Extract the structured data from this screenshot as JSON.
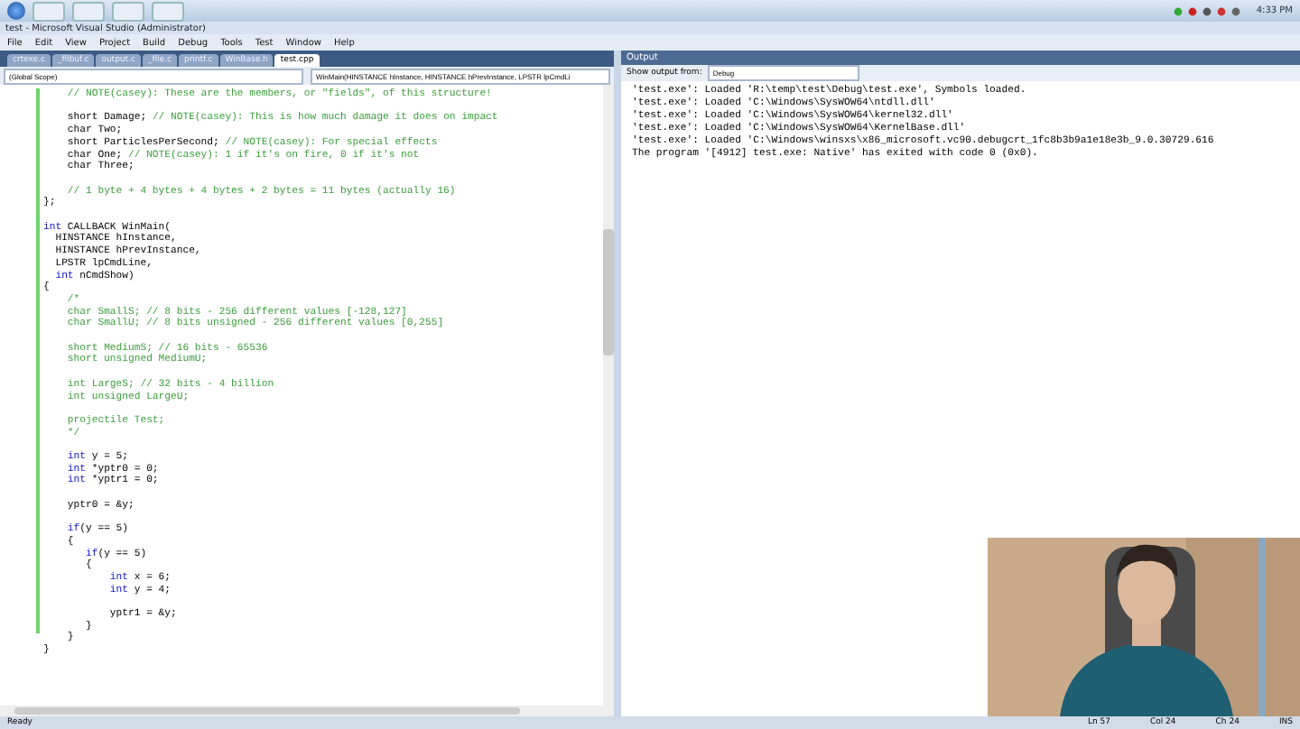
{
  "taskbar": {
    "clock": "4:33 PM"
  },
  "window": {
    "title": "test - Microsoft Visual Studio (Administrator)"
  },
  "menu": [
    "File",
    "Edit",
    "View",
    "Project",
    "Build",
    "Debug",
    "Tools",
    "Test",
    "Window",
    "Help"
  ],
  "tabs": [
    {
      "label": "crtexe.c",
      "selected": false
    },
    {
      "label": "_filbuf.c",
      "selected": false
    },
    {
      "label": "output.c",
      "selected": false
    },
    {
      "label": "_file.c",
      "selected": false
    },
    {
      "label": "printf.c",
      "selected": false
    },
    {
      "label": "WinBase.h",
      "selected": false
    },
    {
      "label": "test.cpp",
      "selected": true
    }
  ],
  "scope": {
    "left": "(Global Scope)",
    "right": "WinMain(HINSTANCE hInstance, HINSTANCE hPrevInstance, LPSTR lpCmdLi"
  },
  "code_blocks": [
    [
      [
        {
          "kind": "c",
          "text": "    // NOTE(casey): These are the members, or \"fields\", of this structure!"
        }
      ]
    ],
    [
      [
        {
          "kind": "p",
          "text": "    short Damage; "
        },
        {
          "kind": "c",
          "text": "// NOTE(casey): This is how much damage it does on impact"
        }
      ],
      [
        {
          "kind": "p",
          "text": "    char Two;"
        }
      ],
      [
        {
          "kind": "p",
          "text": "    short ParticlesPerSecond; "
        },
        {
          "kind": "c",
          "text": "// NOTE(casey): For special effects"
        }
      ],
      [
        {
          "kind": "p",
          "text": "    char One; "
        },
        {
          "kind": "c",
          "text": "// NOTE(casey): 1 if it's on fire, 0 if it's not"
        }
      ],
      [
        {
          "kind": "p",
          "text": "    char Three;"
        }
      ]
    ],
    [
      [
        {
          "kind": "c",
          "text": "    // 1 byte + 4 bytes + 4 bytes + 2 bytes = 11 bytes (actually 16)"
        }
      ],
      [
        {
          "kind": "p",
          "text": "};"
        }
      ]
    ],
    [
      [
        {
          "kind": "k",
          "text": "int"
        },
        {
          "kind": "p",
          "text": " CALLBACK WinMain("
        }
      ],
      [
        {
          "kind": "p",
          "text": "  HINSTANCE hInstance,"
        }
      ],
      [
        {
          "kind": "p",
          "text": "  HINSTANCE hPrevInstance,"
        }
      ],
      [
        {
          "kind": "p",
          "text": "  LPSTR lpCmdLine,"
        }
      ],
      [
        {
          "kind": "k",
          "text": "  int"
        },
        {
          "kind": "p",
          "text": " nCmdShow)"
        }
      ],
      [
        {
          "kind": "p",
          "text": "{"
        }
      ],
      [
        {
          "kind": "c",
          "text": "    /*"
        }
      ],
      [
        {
          "kind": "c",
          "text": "    char SmallS; // 8 bits - 256 different values [-128,127]"
        }
      ],
      [
        {
          "kind": "c",
          "text": "    char SmallU; // 8 bits unsigned - 256 different values [0,255]"
        }
      ]
    ],
    [
      [
        {
          "kind": "c",
          "text": "    short MediumS; // 16 bits - 65536"
        }
      ],
      [
        {
          "kind": "c",
          "text": "    short unsigned MediumU;"
        }
      ]
    ],
    [
      [
        {
          "kind": "c",
          "text": "    int LargeS; // 32 bits - 4 billion"
        }
      ],
      [
        {
          "kind": "c",
          "text": "    int unsigned LargeU;"
        }
      ]
    ],
    [
      [
        {
          "kind": "c",
          "text": "    projectile Test;"
        }
      ],
      [
        {
          "kind": "c",
          "text": "    */"
        }
      ]
    ],
    [
      [
        {
          "kind": "k",
          "text": "    int"
        },
        {
          "kind": "p",
          "text": " y = 5;"
        }
      ],
      [
        {
          "kind": "k",
          "text": "    int"
        },
        {
          "kind": "p",
          "text": " *yptr0 = 0;"
        }
      ],
      [
        {
          "kind": "k",
          "text": "    int"
        },
        {
          "kind": "p",
          "text": " *yptr1 = 0;"
        }
      ]
    ],
    [
      [
        {
          "kind": "p",
          "text": "    yptr0 = &y;"
        }
      ]
    ],
    [
      [
        {
          "kind": "k",
          "text": "    if"
        },
        {
          "kind": "p",
          "text": "(y == 5)"
        }
      ],
      [
        {
          "kind": "p",
          "text": "    {"
        }
      ],
      [
        {
          "kind": "k",
          "text": "       if"
        },
        {
          "kind": "p",
          "text": "(y == 5)"
        }
      ],
      [
        {
          "kind": "p",
          "text": "       {"
        }
      ],
      [
        {
          "kind": "k",
          "text": "           int"
        },
        {
          "kind": "p",
          "text": " x = 6;"
        }
      ],
      [
        {
          "kind": "k",
          "text": "           int"
        },
        {
          "kind": "p",
          "text": " y = 4;"
        }
      ]
    ],
    [
      [
        {
          "kind": "p",
          "text": "           yptr1 = &y;"
        }
      ],
      [
        {
          "kind": "p",
          "text": "       }"
        }
      ],
      [
        {
          "kind": "p",
          "text": "    }"
        }
      ],
      [
        {
          "kind": "p",
          "text": "}"
        }
      ]
    ]
  ],
  "output": {
    "title": "Output",
    "source_label": "Show output from:",
    "source": "Debug",
    "lines": [
      "'test.exe': Loaded 'R:\\temp\\test\\Debug\\test.exe', Symbols loaded.",
      "'test.exe': Loaded 'C:\\Windows\\SysWOW64\\ntdll.dll'",
      "'test.exe': Loaded 'C:\\Windows\\SysWOW64\\kernel32.dll'",
      "'test.exe': Loaded 'C:\\Windows\\SysWOW64\\KernelBase.dll'",
      "'test.exe': Loaded 'C:\\Windows\\winsxs\\x86_microsoft.vc90.debugcrt_1fc8b3b9a1e18e3b_9.0.30729.616",
      "The program '[4912] test.exe: Native' has exited with code 0 (0x0)."
    ]
  },
  "webcam": {
    "kind": "picture"
  },
  "status_bar": {
    "message": "Ready",
    "line": "Ln 57",
    "column": "Col 24",
    "char": "Ch 24",
    "mode": "INS"
  }
}
